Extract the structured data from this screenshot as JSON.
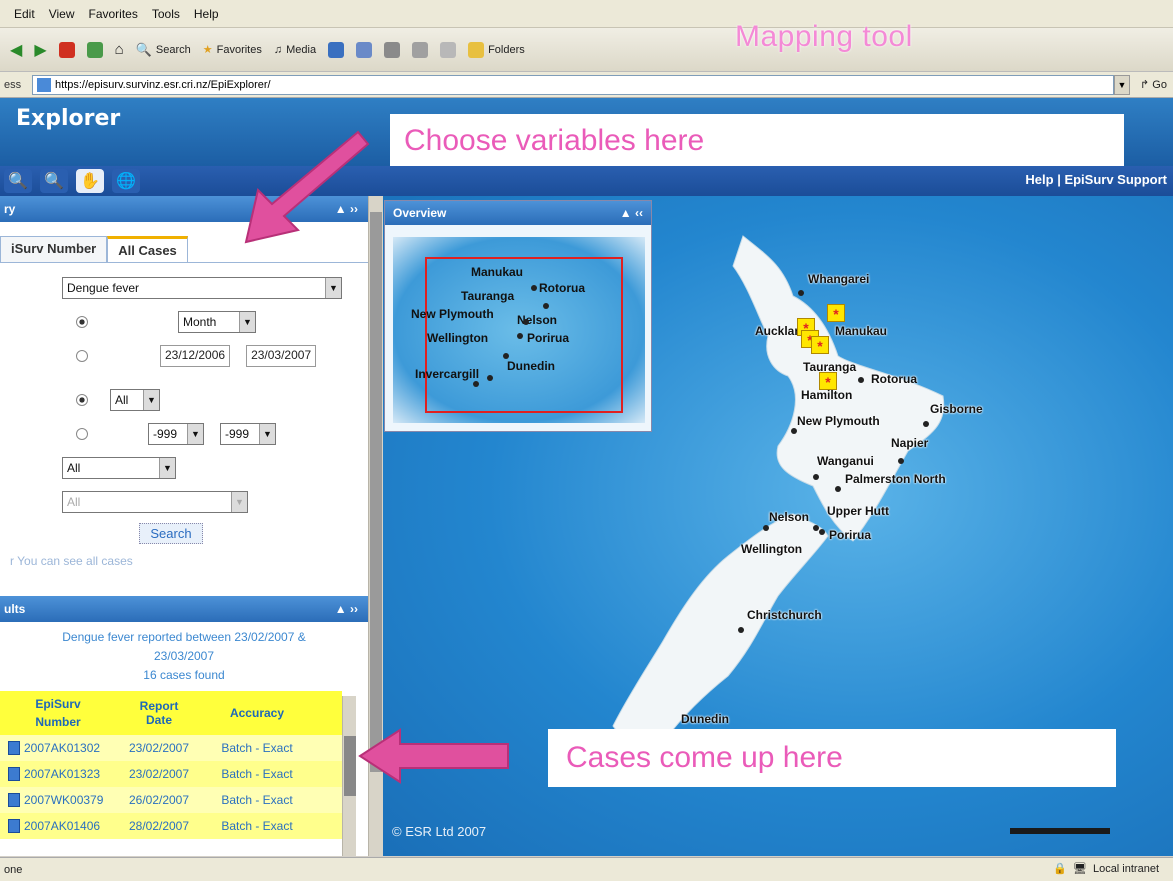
{
  "browser": {
    "menu": [
      "Edit",
      "View",
      "Favorites",
      "Tools",
      "Help"
    ],
    "toolbar": {
      "search": "Search",
      "favorites": "Favorites",
      "media": "Media",
      "folders": "Folders"
    },
    "address_label": "ess",
    "url": "https://episurv.survinz.esr.cri.nz/EpiExplorer/",
    "go": "Go",
    "status_left": "one",
    "zone": "Local intranet"
  },
  "overlay_notes": {
    "mapping_tool": "Mapping tool",
    "choose": "Choose variables here",
    "cases": "Cases come up here"
  },
  "app": {
    "title": "Explorer",
    "help_links": "Help | EpiSurv Support"
  },
  "query_panel": {
    "header": "ry",
    "tabs": [
      "iSurv Number",
      "All Cases"
    ],
    "disease_value": "Dengue fever",
    "period_value": "Month",
    "date_from": "23/12/2006",
    "date_to": "23/03/2007",
    "age_value": "All",
    "range_from": "-999",
    "range_to": "-999",
    "filter1_value": "All",
    "filter2_value": "All",
    "search_button": "Search",
    "hint": "r You can see all cases"
  },
  "results_panel": {
    "header": "ults",
    "summary_line1": "Dengue fever reported between 23/02/2007 &",
    "summary_line2": "23/03/2007",
    "summary_line3": "16 cases found",
    "columns": [
      [
        "EpiSurv",
        "Number"
      ],
      [
        "Report",
        "Date"
      ],
      [
        "Accuracy"
      ]
    ],
    "rows": [
      {
        "number": "2007AK01302",
        "date": "23/02/2007",
        "accuracy": "Batch - Exact"
      },
      {
        "number": "2007AK01323",
        "date": "23/02/2007",
        "accuracy": "Batch - Exact"
      },
      {
        "number": "2007WK00379",
        "date": "26/02/2007",
        "accuracy": "Batch - Exact"
      },
      {
        "number": "2007AK01406",
        "date": "28/02/2007",
        "accuracy": "Batch - Exact"
      }
    ]
  },
  "overview": {
    "header": "Overview",
    "places": [
      "Manukau",
      "Rotorua",
      "Tauranga",
      "New Plymouth",
      "Nelson",
      "Wellington",
      "Porirua",
      "Dunedin",
      "Invercargill"
    ]
  },
  "map": {
    "places": [
      "Whangarei",
      "Auckland",
      "Manukau",
      "Tauranga",
      "Rotorua",
      "Hamilton",
      "Gisborne",
      "New Plymouth",
      "Napier",
      "Wanganui",
      "Palmerston North",
      "Nelson",
      "Upper Hutt",
      "Porirua",
      "Wellington",
      "Christchurch",
      "Dunedin"
    ],
    "copyright": "© ESR Ltd 2007",
    "marker_symbol": "*"
  }
}
